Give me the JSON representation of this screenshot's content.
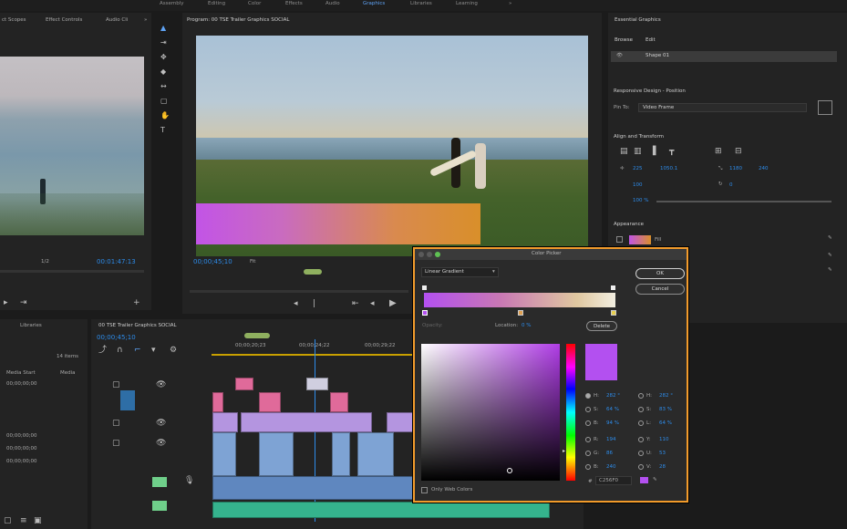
{
  "workspaces": [
    "Assembly",
    "Editing",
    "Color",
    "Effects",
    "Audio",
    "Graphics",
    "Libraries",
    "Learning",
    "»"
  ],
  "source_panel": {
    "tabs": [
      "ct Scopes",
      "Effect Controls",
      "Audio Cli"
    ],
    "timecode": "00:01:47:13",
    "scale": "1/2"
  },
  "program_panel": {
    "title": "Program: 00 TSE Trailer Graphics SOCIAL",
    "timecode": "00;00;45;10",
    "fit": "Fit"
  },
  "essential_graphics": {
    "title": "Essential Graphics",
    "tabs": [
      "Browse",
      "Edit"
    ],
    "layer": "Shape 01",
    "responsive_label": "Responsive Design - Position",
    "pin_to_label": "Pin To:",
    "pin_to_value": "Video Frame",
    "align_label": "Align and Transform",
    "x_value": "225",
    "y_value": "1050.1",
    "w_value": "1180",
    "h_value": "240",
    "scale_value": "100",
    "rotation_value": "0",
    "opacity_value": "100 %",
    "appearance_label": "Appearance",
    "fill_label": "Fill"
  },
  "project_panel": {
    "tab": "Libraries",
    "items_count": "14 items",
    "col_media_start": "Media Start",
    "col_media_end": "Media",
    "rows": [
      "00;00;00;00",
      "00;00;00;00",
      "00;00;00;00",
      "00;00;00;00"
    ]
  },
  "timeline": {
    "title": "00 TSE Trailer Graphics SOCIAL",
    "timecode": "00;00;45;10",
    "ruler": [
      "00;00;20;23",
      "00;00;24;22",
      "00;00;29;22"
    ]
  },
  "color_picker": {
    "title": "Color Picker",
    "mode": "Linear Gradient",
    "ok": "OK",
    "cancel": "Cancel",
    "opacity_label": "Opacity:",
    "location_label": "Location:",
    "location_value": "0 %",
    "delete_label": "Delete",
    "only_web_colors": "Only Web Colors",
    "hex": "C256F0",
    "fields_left": [
      {
        "label": "H:",
        "value": "282 °"
      },
      {
        "label": "S:",
        "value": "64 %"
      },
      {
        "label": "B:",
        "value": "94 %"
      },
      {
        "label": "R:",
        "value": "194"
      },
      {
        "label": "G:",
        "value": "86"
      },
      {
        "label": "B:",
        "value": "240"
      }
    ],
    "fields_right": [
      {
        "label": "H:",
        "value": "282 °"
      },
      {
        "label": "S:",
        "value": "83 %"
      },
      {
        "label": "L:",
        "value": "64 %"
      },
      {
        "label": "Y:",
        "value": "110"
      },
      {
        "label": "U:",
        "value": "53"
      },
      {
        "label": "V:",
        "value": "28"
      }
    ]
  }
}
